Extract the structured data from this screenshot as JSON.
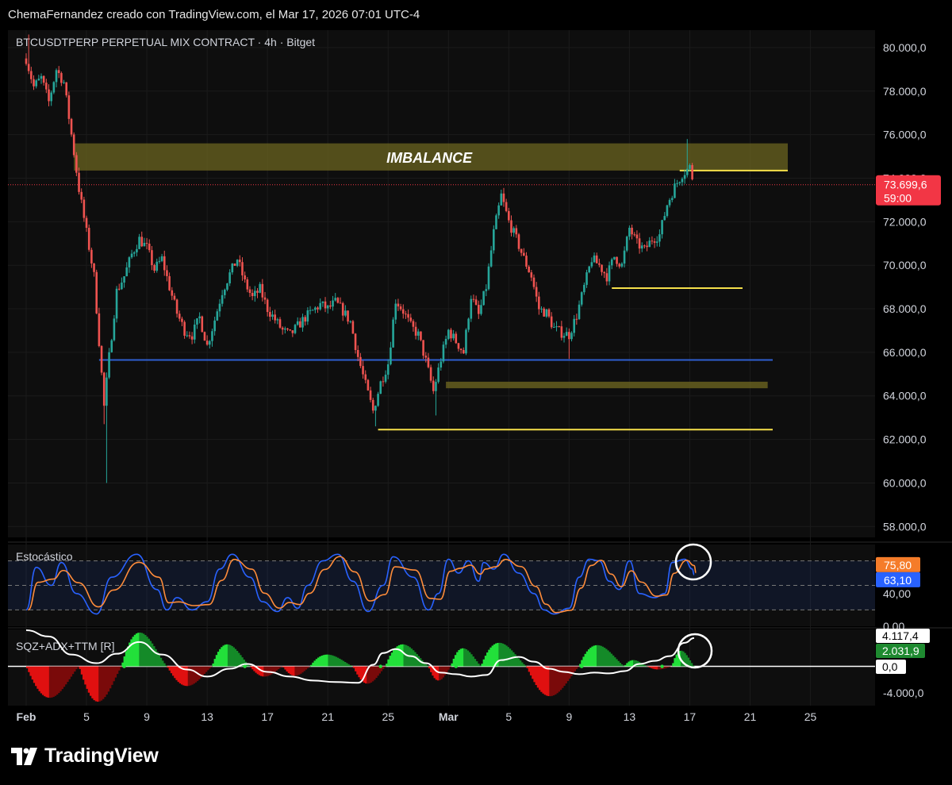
{
  "header": {
    "text": "ChemaFernandez creado con TradingView.com, el Mar 17, 2026 07:01 UTC-4"
  },
  "symbol_title": "BTCUSDTPERP PERPETUAL MIX CONTRACT · 4h · Bitget",
  "brand": {
    "name": "TradingView"
  },
  "colors": {
    "background": "#000000",
    "panel": "#0e0e0e",
    "up": "#26a69a",
    "down": "#ef5350",
    "level_yellow": "#f5e04a",
    "zone_olive": "#6b6420",
    "support_blue": "#2f5fd0",
    "stoch_k": "#2962ff",
    "stoch_d": "#ff8c3a",
    "sqz_bright_green": "#22e03a",
    "sqz_dark_green": "#148a28",
    "sqz_red": "#e01010",
    "sqz_dark_red": "#7a0a0a",
    "price_label": "#f23645",
    "stoch_k_label": "#2962ff",
    "stoch_d_label": "#f57c2a",
    "sqz_val_label": "#1e8a30"
  },
  "annotations": {
    "imbalance_label": "IMBALANCE",
    "circle_icons": [
      "circle-annotation-icon",
      "circle-annotation-icon"
    ]
  },
  "chart_data": [
    {
      "type": "candlestick",
      "title": "BTCUSDTPERP PERPETUAL MIX CONTRACT · 4h · Bitget",
      "x_ticks": [
        "Feb",
        "5",
        "9",
        "13",
        "17",
        "21",
        "25",
        "Mar",
        "5",
        "9",
        "13",
        "17",
        "21",
        "25"
      ],
      "x_tick_dates": [
        "2026-02-01",
        "2026-02-05",
        "2026-02-09",
        "2026-02-13",
        "2026-02-17",
        "2026-02-21",
        "2026-02-25",
        "2026-03-01",
        "2026-03-05",
        "2026-03-09",
        "2026-03-13",
        "2026-03-17",
        "2026-03-21",
        "2026-03-25"
      ],
      "y_ticks": [
        "80.000,0",
        "78.000,0",
        "76.000,0",
        "74.000,0",
        "72.000,0",
        "70.000,0",
        "68.000,0",
        "66.000,0",
        "64.000,0",
        "62.000,0",
        "60.000,0",
        "58.000,0"
      ],
      "ylim": [
        57500,
        80800
      ],
      "last_price": 73699.6,
      "last_price_label": "73.699,6",
      "countdown_label": "59:00",
      "close_path": [
        [
          "2026-02-01T00:00",
          79500
        ],
        [
          "2026-02-01T12:00",
          78200
        ],
        [
          "2026-02-02T00:00",
          78600
        ],
        [
          "2026-02-02T12:00",
          77500
        ],
        [
          "2026-02-03T00:00",
          79000
        ],
        [
          "2026-02-03T12:00",
          78400
        ],
        [
          "2026-02-04T00:00",
          76000
        ],
        [
          "2026-02-04T12:00",
          73500
        ],
        [
          "2026-02-05T00:00",
          71500
        ],
        [
          "2026-02-05T12:00",
          69500
        ],
        [
          "2026-02-05T20:00",
          66500
        ],
        [
          "2026-02-06T04:00",
          63500
        ],
        [
          "2026-02-06T12:00",
          65800
        ],
        [
          "2026-02-07T00:00",
          68800
        ],
        [
          "2026-02-07T12:00",
          69500
        ],
        [
          "2026-02-08T00:00",
          70500
        ],
        [
          "2026-02-08T12:00",
          71200
        ],
        [
          "2026-02-09T00:00",
          70800
        ],
        [
          "2026-02-09T12:00",
          69800
        ],
        [
          "2026-02-10T00:00",
          70300
        ],
        [
          "2026-02-10T12:00",
          69000
        ],
        [
          "2026-02-11T00:00",
          67800
        ],
        [
          "2026-02-11T12:00",
          67000
        ],
        [
          "2026-02-12T00:00",
          66800
        ],
        [
          "2026-02-12T12:00",
          67600
        ],
        [
          "2026-02-13T00:00",
          66300
        ],
        [
          "2026-02-13T12:00",
          67500
        ],
        [
          "2026-02-14T00:00",
          68800
        ],
        [
          "2026-02-14T12:00",
          69600
        ],
        [
          "2026-02-15T00:00",
          70300
        ],
        [
          "2026-02-15T12:00",
          69200
        ],
        [
          "2026-02-16T00:00",
          68500
        ],
        [
          "2026-02-16T12:00",
          68900
        ],
        [
          "2026-02-17T00:00",
          68000
        ],
        [
          "2026-02-17T12:00",
          67500
        ],
        [
          "2026-02-18T00:00",
          67000
        ],
        [
          "2026-02-18T12:00",
          66800
        ],
        [
          "2026-02-19T00:00",
          67200
        ],
        [
          "2026-02-19T12:00",
          67600
        ],
        [
          "2026-02-20T00:00",
          67900
        ],
        [
          "2026-02-20T12:00",
          68200
        ],
        [
          "2026-02-21T00:00",
          68000
        ],
        [
          "2026-02-21T12:00",
          68300
        ],
        [
          "2026-02-22T00:00",
          67900
        ],
        [
          "2026-02-22T12:00",
          67400
        ],
        [
          "2026-02-23T00:00",
          65800
        ],
        [
          "2026-02-23T12:00",
          64500
        ],
        [
          "2026-02-24T00:00",
          63300
        ],
        [
          "2026-02-24T12:00",
          64600
        ],
        [
          "2026-02-25T00:00",
          65500
        ],
        [
          "2026-02-25T12:00",
          68400
        ],
        [
          "2026-02-26T00:00",
          67900
        ],
        [
          "2026-02-26T12:00",
          67200
        ],
        [
          "2026-02-27T00:00",
          66800
        ],
        [
          "2026-02-27T12:00",
          65600
        ],
        [
          "2026-02-28T00:00",
          64200
        ],
        [
          "2026-02-28T12:00",
          65700
        ],
        [
          "2026-03-01T00:00",
          67000
        ],
        [
          "2026-03-01T12:00",
          66500
        ],
        [
          "2026-03-02T00:00",
          66000
        ],
        [
          "2026-03-02T12:00",
          68600
        ],
        [
          "2026-03-03T00:00",
          67700
        ],
        [
          "2026-03-03T12:00",
          69000
        ],
        [
          "2026-03-04T00:00",
          71500
        ],
        [
          "2026-03-04T12:00",
          73200
        ],
        [
          "2026-03-05T00:00",
          72000
        ],
        [
          "2026-03-05T12:00",
          71200
        ],
        [
          "2026-03-06T00:00",
          70300
        ],
        [
          "2026-03-06T12:00",
          69500
        ],
        [
          "2026-03-07T00:00",
          68000
        ],
        [
          "2026-03-07T12:00",
          67800
        ],
        [
          "2026-03-08T00:00",
          67100
        ],
        [
          "2026-03-08T12:00",
          66900
        ],
        [
          "2026-03-09T00:00",
          66800
        ],
        [
          "2026-03-09T12:00",
          67700
        ],
        [
          "2026-03-10T00:00",
          69000
        ],
        [
          "2026-03-10T12:00",
          70300
        ],
        [
          "2026-03-11T00:00",
          70000
        ],
        [
          "2026-03-11T12:00",
          69500
        ],
        [
          "2026-03-12T00:00",
          70400
        ],
        [
          "2026-03-12T12:00",
          70000
        ],
        [
          "2026-03-13T00:00",
          71700
        ],
        [
          "2026-03-13T12:00",
          71000
        ],
        [
          "2026-03-14T00:00",
          70700
        ],
        [
          "2026-03-14T12:00",
          71200
        ],
        [
          "2026-03-15T00:00",
          71400
        ],
        [
          "2026-03-15T12:00",
          72800
        ],
        [
          "2026-03-16T00:00",
          73600
        ],
        [
          "2026-03-16T12:00",
          74200
        ],
        [
          "2026-03-17T00:00",
          74500
        ],
        [
          "2026-03-17T07:00",
          73700
        ]
      ],
      "events": [
        [
          "2026-02-01T04:00",
          80600
        ],
        [
          "2026-02-06T04:00",
          62700
        ],
        [
          "2026-02-06T08:00",
          60000
        ],
        [
          "2026-02-24T04:00",
          62600
        ],
        [
          "2026-02-28T04:00",
          63100
        ],
        [
          "2026-03-04T16:00",
          73500
        ],
        [
          "2026-03-09T00:00",
          65700
        ],
        [
          "2026-03-16T20:00",
          75800
        ]
      ],
      "zones": [
        {
          "label": "IMBALANCE",
          "from": "2026-02-04T04:00",
          "to": "2026-03-23T12:00",
          "low": 74350,
          "high": 75600
        },
        {
          "label": "",
          "from": "2026-02-28T20:00",
          "to": "2026-03-22T04:00",
          "low": 64350,
          "high": 64650
        }
      ],
      "horizontal_levels": [
        {
          "name": "support-blue",
          "price": 65650,
          "from": "2026-02-05T20:00",
          "to": "2026-03-22T12:00"
        },
        {
          "name": "resistance-yellow",
          "price": 74350,
          "from": "2026-03-16T08:00",
          "to": "2026-03-23T12:00"
        },
        {
          "name": "level-yellow-mid",
          "price": 68950,
          "from": "2026-03-11T20:00",
          "to": "2026-03-20T12:00"
        },
        {
          "name": "level-yellow-low",
          "price": 62450,
          "from": "2026-02-24T08:00",
          "to": "2026-03-22T12:00"
        }
      ]
    },
    {
      "type": "line",
      "title": "Estocástico",
      "y_ticks": [
        "40,00",
        "0,00"
      ],
      "ylim": [
        0,
        100
      ],
      "band": [
        20,
        80
      ],
      "mid_line": 50,
      "series": [
        {
          "name": "",
          "last_value": 63.1,
          "last_label": "63,10"
        },
        {
          "name": "",
          "last_value": 75.8,
          "last_label": "75,80"
        }
      ],
      "oscillation_peaks": [
        [
          "2026-02-01T00:00",
          20
        ],
        [
          "2026-02-01T16:00",
          72
        ],
        [
          "2026-02-02T16:00",
          50
        ],
        [
          "2026-02-03T08:00",
          78
        ],
        [
          "2026-02-04T08:00",
          40
        ],
        [
          "2026-02-05T16:00",
          15
        ],
        [
          "2026-02-06T16:00",
          60
        ],
        [
          "2026-02-08T08:00",
          88
        ],
        [
          "2026-02-09T16:00",
          45
        ],
        [
          "2026-02-10T08:00",
          20
        ],
        [
          "2026-02-11T00:00",
          35
        ],
        [
          "2026-02-12T00:00",
          20
        ],
        [
          "2026-02-13T00:00",
          30
        ],
        [
          "2026-02-13T20:00",
          70
        ],
        [
          "2026-02-14T16:00",
          88
        ],
        [
          "2026-02-15T20:00",
          60
        ],
        [
          "2026-02-16T16:00",
          30
        ],
        [
          "2026-02-17T16:00",
          18
        ],
        [
          "2026-02-18T08:00",
          35
        ],
        [
          "2026-02-19T00:00",
          22
        ],
        [
          "2026-02-19T16:00",
          50
        ],
        [
          "2026-02-20T16:00",
          80
        ],
        [
          "2026-02-21T16:00",
          88
        ],
        [
          "2026-02-22T16:00",
          55
        ],
        [
          "2026-02-23T16:00",
          18
        ],
        [
          "2026-02-24T16:00",
          50
        ],
        [
          "2026-02-25T08:00",
          85
        ],
        [
          "2026-02-26T16:00",
          60
        ],
        [
          "2026-02-27T16:00",
          20
        ],
        [
          "2026-02-28T08:00",
          40
        ],
        [
          "2026-03-01T00:00",
          82
        ],
        [
          "2026-03-01T16:00",
          65
        ],
        [
          "2026-03-02T08:00",
          80
        ],
        [
          "2026-03-03T00:00",
          55
        ],
        [
          "2026-03-03T08:00",
          78
        ],
        [
          "2026-03-04T00:00",
          70
        ],
        [
          "2026-03-04T16:00",
          88
        ],
        [
          "2026-03-05T16:00",
          65
        ],
        [
          "2026-03-06T16:00",
          40
        ],
        [
          "2026-03-07T08:00",
          20
        ],
        [
          "2026-03-08T00:00",
          15
        ],
        [
          "2026-03-09T00:00",
          22
        ],
        [
          "2026-03-09T16:00",
          60
        ],
        [
          "2026-03-10T08:00",
          82
        ],
        [
          "2026-03-11T00:00",
          80
        ],
        [
          "2026-03-11T16:00",
          55
        ],
        [
          "2026-03-12T08:00",
          45
        ],
        [
          "2026-03-13T00:00",
          80
        ],
        [
          "2026-03-13T16:00",
          40
        ],
        [
          "2026-03-14T16:00",
          35
        ],
        [
          "2026-03-15T08:00",
          40
        ],
        [
          "2026-03-15T20:00",
          78
        ],
        [
          "2026-03-16T16:00",
          82
        ],
        [
          "2026-03-17T04:00",
          70
        ],
        [
          "2026-03-17T07:00",
          63
        ]
      ]
    },
    {
      "type": "area",
      "title": "SQZ+ADX+TTM [R]",
      "y_ticks": [
        "4.117,4",
        "2.031,9",
        "0,0",
        "-4.000,0"
      ],
      "ylim": [
        -5000,
        4700
      ],
      "value_labels": {
        "adx": "4.117,4",
        "momentum": "2.031,9",
        "zero": "0,0"
      },
      "momentum_lobes": [
        {
          "from": "2026-02-01T00:00",
          "to": "2026-02-04T12:00",
          "peak": -4000
        },
        {
          "from": "2026-02-04T12:00",
          "to": "2026-02-07T08:00",
          "peak": -4500
        },
        {
          "from": "2026-02-07T08:00",
          "to": "2026-02-10T08:00",
          "peak": 4300
        },
        {
          "from": "2026-02-10T08:00",
          "to": "2026-02-13T08:00",
          "peak": -2500
        },
        {
          "from": "2026-02-13T08:00",
          "to": "2026-02-15T20:00",
          "peak": 2800
        },
        {
          "from": "2026-02-15T20:00",
          "to": "2026-02-18T00:00",
          "peak": -1300
        },
        {
          "from": "2026-02-18T00:00",
          "to": "2026-02-19T20:00",
          "peak": -1200
        },
        {
          "from": "2026-02-19T20:00",
          "to": "2026-02-22T16:00",
          "peak": 1500
        },
        {
          "from": "2026-02-22T16:00",
          "to": "2026-02-24T20:00",
          "peak": -2200
        },
        {
          "from": "2026-02-24T20:00",
          "to": "2026-02-27T16:00",
          "peak": 2800
        },
        {
          "from": "2026-02-27T16:00",
          "to": "2026-03-01T04:00",
          "peak": -1800
        },
        {
          "from": "2026-03-01T04:00",
          "to": "2026-03-03T04:00",
          "peak": 2300
        },
        {
          "from": "2026-03-03T04:00",
          "to": "2026-03-06T04:00",
          "peak": 3000
        },
        {
          "from": "2026-03-06T04:00",
          "to": "2026-03-09T16:00",
          "peak": -3800
        },
        {
          "from": "2026-03-09T16:00",
          "to": "2026-03-12T16:00",
          "peak": 2700
        },
        {
          "from": "2026-03-12T16:00",
          "to": "2026-03-14T04:00",
          "peak": 800
        },
        {
          "from": "2026-03-14T04:00",
          "to": "2026-03-15T20:00",
          "peak": -400
        },
        {
          "from": "2026-03-15T20:00",
          "to": "2026-03-17T07:00",
          "peak": 2000
        }
      ],
      "adx_line": [
        [
          "2026-02-01T00:00",
          4600
        ],
        [
          "2026-02-02T12:00",
          3800
        ],
        [
          "2026-02-04T00:00",
          1500
        ],
        [
          "2026-02-05T16:00",
          400
        ],
        [
          "2026-02-07T00:00",
          1600
        ],
        [
          "2026-02-08T12:00",
          3100
        ],
        [
          "2026-02-10T00:00",
          1500
        ],
        [
          "2026-02-11T16:00",
          -400
        ],
        [
          "2026-02-13T00:00",
          -1300
        ],
        [
          "2026-02-14T12:00",
          -300
        ],
        [
          "2026-02-15T16:00",
          300
        ],
        [
          "2026-02-17T00:00",
          -700
        ],
        [
          "2026-02-18T12:00",
          -1300
        ],
        [
          "2026-02-20T00:00",
          -1800
        ],
        [
          "2026-02-21T12:00",
          -2000
        ],
        [
          "2026-02-23T00:00",
          -2100
        ],
        [
          "2026-02-24T00:00",
          200
        ],
        [
          "2026-02-24T16:00",
          1700
        ],
        [
          "2026-02-25T12:00",
          2200
        ],
        [
          "2026-02-26T12:00",
          1300
        ],
        [
          "2026-02-27T12:00",
          400
        ],
        [
          "2026-02-28T12:00",
          -800
        ],
        [
          "2026-03-01T12:00",
          -1000
        ],
        [
          "2026-03-02T12:00",
          -1300
        ],
        [
          "2026-03-03T12:00",
          -1100
        ],
        [
          "2026-03-04T12:00",
          800
        ],
        [
          "2026-03-05T16:00",
          1200
        ],
        [
          "2026-03-06T16:00",
          600
        ],
        [
          "2026-03-07T16:00",
          -300
        ],
        [
          "2026-03-08T16:00",
          -700
        ],
        [
          "2026-03-09T16:00",
          -1000
        ],
        [
          "2026-03-10T16:00",
          -800
        ],
        [
          "2026-03-11T16:00",
          -900
        ],
        [
          "2026-03-12T16:00",
          -600
        ],
        [
          "2026-03-13T16:00",
          300
        ],
        [
          "2026-03-14T16:00",
          700
        ],
        [
          "2026-03-15T16:00",
          1300
        ],
        [
          "2026-03-16T16:00",
          3000
        ],
        [
          "2026-03-17T07:00",
          3600
        ]
      ]
    }
  ]
}
